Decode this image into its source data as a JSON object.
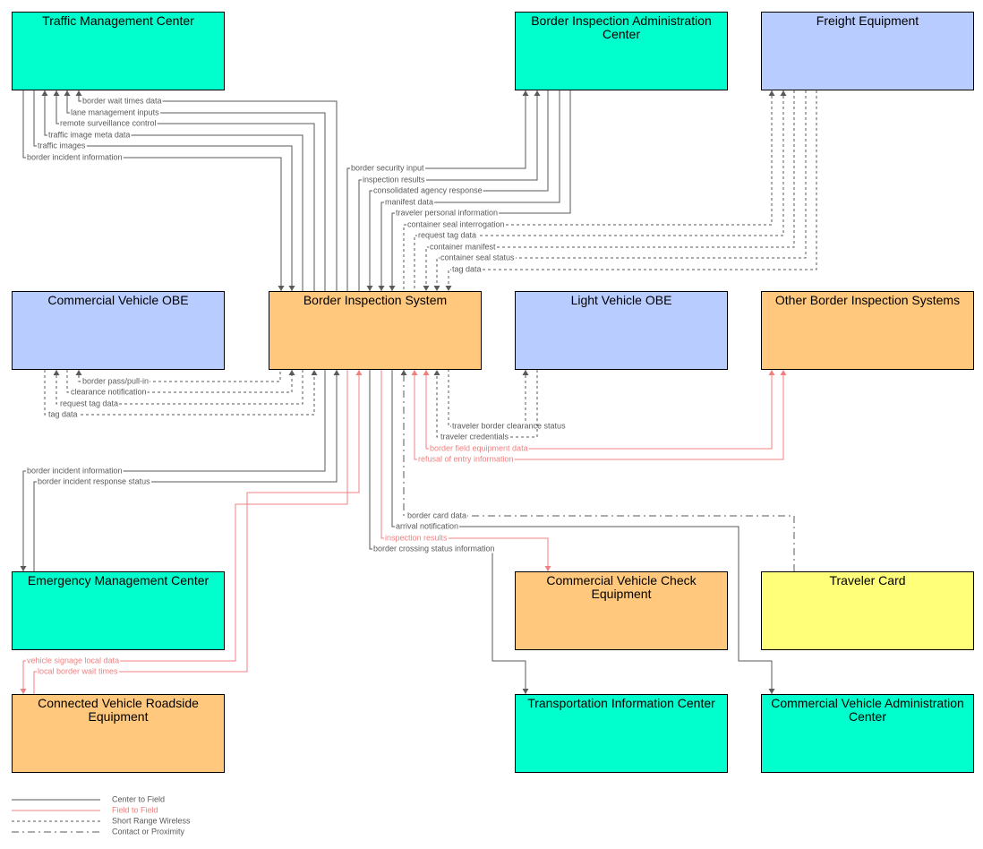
{
  "colors": {
    "center": "#00FFCC",
    "field": "#FFC87C",
    "vehicle": "#B8CCFF",
    "traveler": "#FFFF7A",
    "center_to_field": "#5a5a5a",
    "field_to_field": "#f08080",
    "wireless": "#5a5a5a",
    "contact": "#5a5a5a"
  },
  "boxes": {
    "tmc": "Traffic Management Center",
    "biac": "Border Inspection Administration Center",
    "freight": "Freight Equipment",
    "cvobe": "Commercial Vehicle OBE",
    "bis": "Border Inspection System",
    "lvobe": "Light Vehicle OBE",
    "obis": "Other Border Inspection Systems",
    "emc": "Emergency Management Center",
    "cvce": "Commercial Vehicle Check Equipment",
    "tcard": "Traveler Card",
    "cvrse": "Connected Vehicle Roadside Equipment",
    "tic": "Transportation Information Center",
    "cvac": "Commercial Vehicle Administration Center"
  },
  "flows": {
    "tmc": [
      "border wait times data",
      "lane management inputs",
      "remote surveillance control",
      "traffic image meta data",
      "traffic images",
      "border incident information"
    ],
    "biac": [
      "border security input",
      "inspection results",
      "consolidated agency response",
      "manifest data",
      "traveler personal information"
    ],
    "freight": [
      "container seal interrogation",
      "request tag data",
      "container manifest",
      "container seal status",
      "tag data"
    ],
    "cvobe": [
      "border pass/pull-in",
      "clearance notification",
      "request tag data",
      "tag data"
    ],
    "lvobe": [
      "traveler border clearance status",
      "traveler credentials"
    ],
    "obis": [
      "border field equipment data",
      "refusal of entry information"
    ],
    "emc": [
      "border incident information",
      "border incident response status"
    ],
    "cvrse": [
      "vehicle signage local data",
      "local border wait times"
    ],
    "tcard": [
      "border card data"
    ],
    "cvac": [
      "arrival notification"
    ],
    "cvce": [
      "inspection results"
    ],
    "tic": [
      "border crossing status information"
    ]
  },
  "legend": [
    {
      "label": "Center to Field",
      "style": "solid",
      "color": "#5a5a5a"
    },
    {
      "label": "Field to Field",
      "style": "solid",
      "color": "#f08080"
    },
    {
      "label": "Short Range Wireless",
      "style": "dashed",
      "color": "#5a5a5a"
    },
    {
      "label": "Contact or Proximity",
      "style": "dashdot",
      "color": "#5a5a5a"
    }
  ]
}
